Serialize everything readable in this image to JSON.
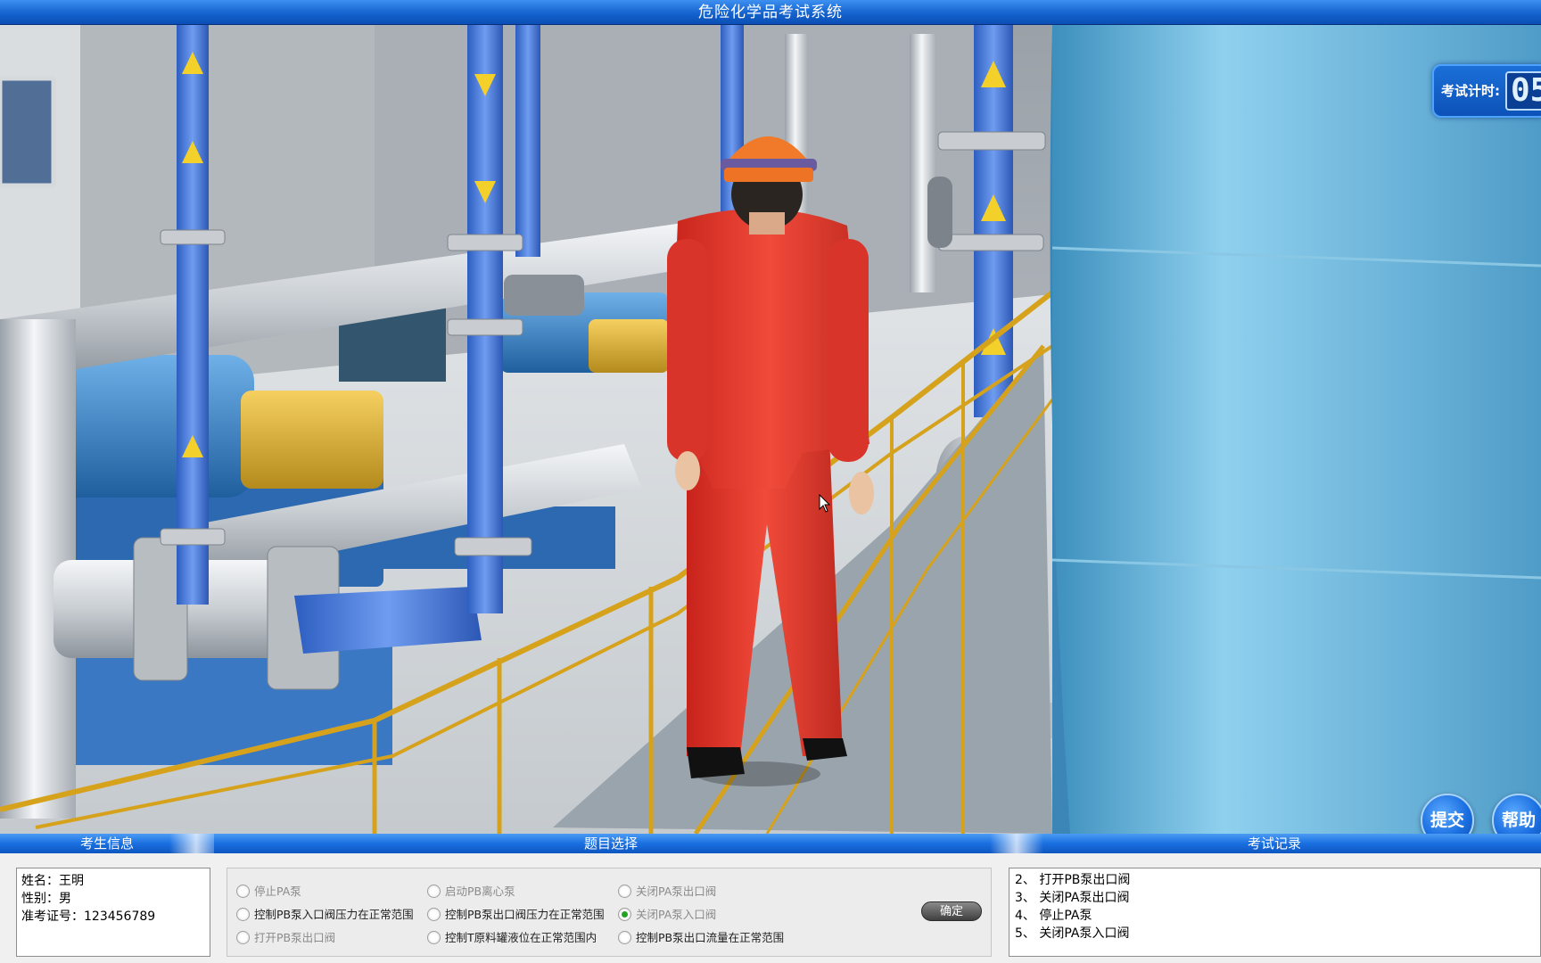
{
  "app": {
    "title": "危险化学品考试系统"
  },
  "timer": {
    "label": "考试计时:",
    "value": "05"
  },
  "actions": {
    "submit_label": "提交",
    "help_label": "帮助"
  },
  "panels": {
    "info_header": "考生信息",
    "select_header": "题目选择",
    "record_header": "考试记录"
  },
  "candidate": {
    "name_line": "姓名：王明",
    "gender_line": "性别：男",
    "id_line": "准考证号：123456789"
  },
  "options": [
    {
      "label": "停止PA泵",
      "selected": false,
      "dimmed": true
    },
    {
      "label": "启动PB离心泵",
      "selected": false,
      "dimmed": true
    },
    {
      "label": "关闭PA泵出口阀",
      "selected": false,
      "dimmed": true
    },
    {
      "label": "控制PB泵入口阀压力在正常范围",
      "selected": false,
      "dimmed": false
    },
    {
      "label": "控制PB泵出口阀压力在正常范围",
      "selected": false,
      "dimmed": false
    },
    {
      "label": "关闭PA泵入口阀",
      "selected": true,
      "dimmed": true
    },
    {
      "label": "打开PB泵出口阀",
      "selected": false,
      "dimmed": true
    },
    {
      "label": "控制T原料罐液位在正常范围内",
      "selected": false,
      "dimmed": false
    },
    {
      "label": "控制PB泵出口流量在正常范围",
      "selected": false,
      "dimmed": false
    }
  ],
  "confirm_label": "确定",
  "records": [
    "2、 打开PB泵出口阀",
    "3、 关闭PA泵出口阀",
    "4、 停止PA泵",
    "5、 关闭PA泵入口阀"
  ],
  "colors": {
    "header_blue": "#1a6fe0",
    "pipe_blue": "#4a78d8",
    "worker_red": "#e6352b",
    "helmet_orange": "#f07a2a",
    "tank_cyan": "#6fb8dc",
    "railing_yellow": "#d6a21c"
  },
  "icons": {
    "cursor": "mouse-pointer-icon"
  }
}
